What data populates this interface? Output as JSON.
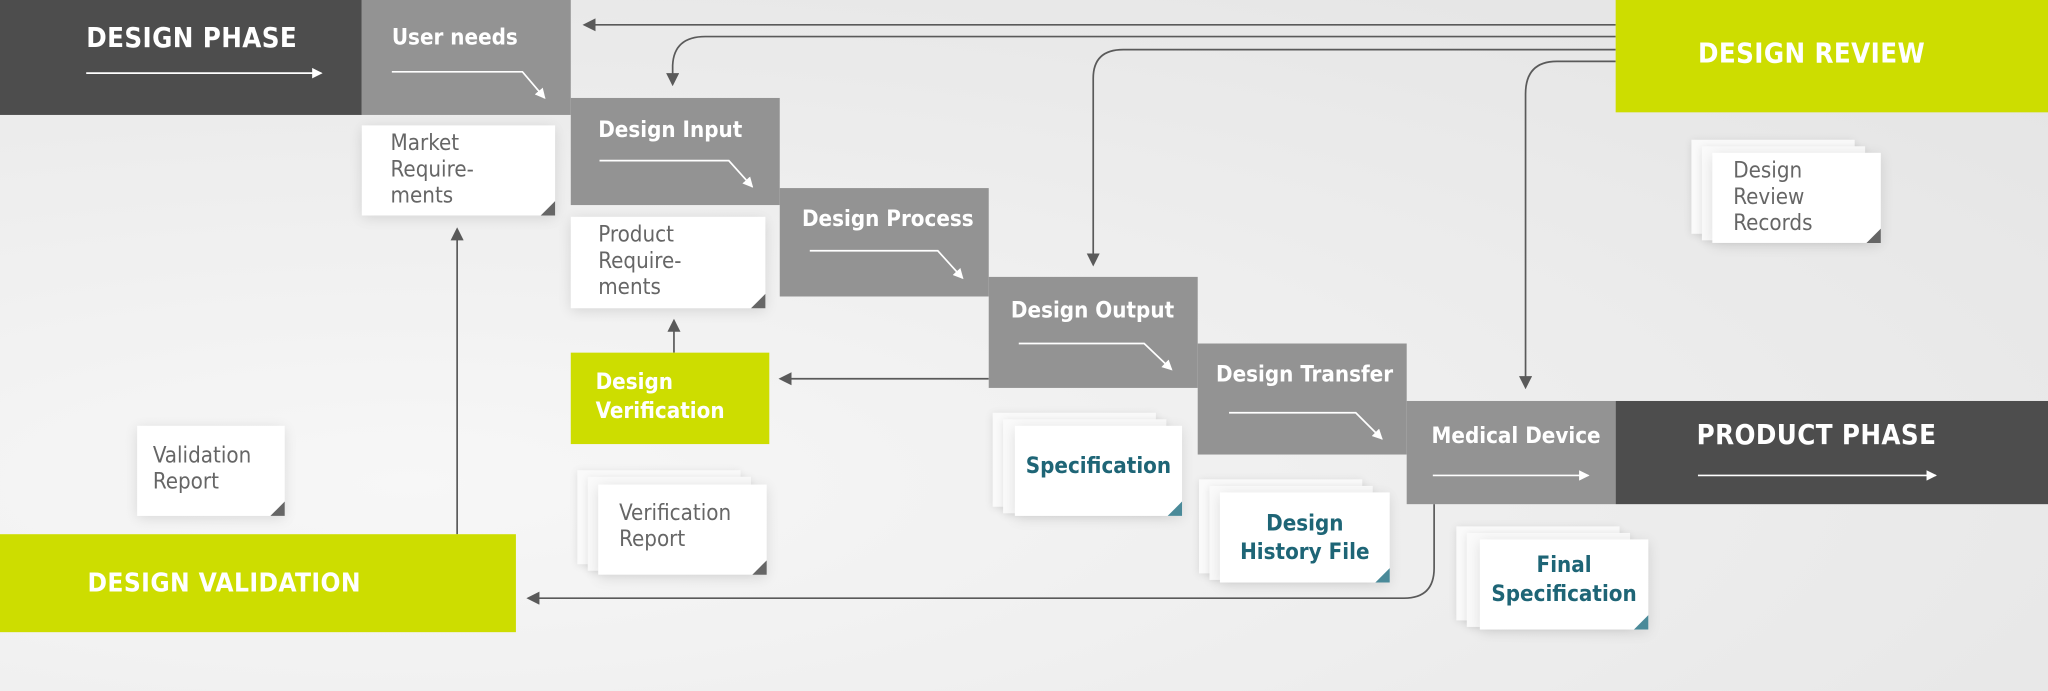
{
  "phases": {
    "design_phase": "DESIGN PHASE",
    "product_phase": "PRODUCT PHASE",
    "design_review": "DESIGN REVIEW",
    "design_validation": "DESIGN VALIDATION",
    "design_verification": "Design Verification"
  },
  "steps": [
    "User needs",
    "Design Input",
    "Design Process",
    "Design Output",
    "Design Transfer",
    "Medical Device"
  ],
  "documents": {
    "market_requirements": "Market Requirements",
    "product_requirements": "Product Requirements",
    "design_review_records": "Design Review Records",
    "verification_report": "Verification Report",
    "validation_report": "Validation Report",
    "specification": "Specification",
    "design_history_file": "Design History File",
    "final_specification": "Final Specification"
  },
  "doc_lines": {
    "market": [
      "Market",
      "Require-",
      "ments"
    ],
    "product": [
      "Product",
      "Require-",
      "ments"
    ],
    "review": [
      "Design",
      "Review",
      "Records"
    ],
    "verification": [
      "Verification",
      "Report"
    ],
    "validation": [
      "Validation",
      "Report"
    ],
    "dhf": [
      "Design",
      "History File"
    ],
    "final": [
      "Final",
      "Specification"
    ],
    "verif_box": [
      "Design",
      "Verification"
    ]
  },
  "colors": {
    "dark": "#4d4d4d",
    "gray": "#939393",
    "lime": "#cddd00",
    "teal": "#1e6576",
    "line": "#5a5a5a"
  }
}
